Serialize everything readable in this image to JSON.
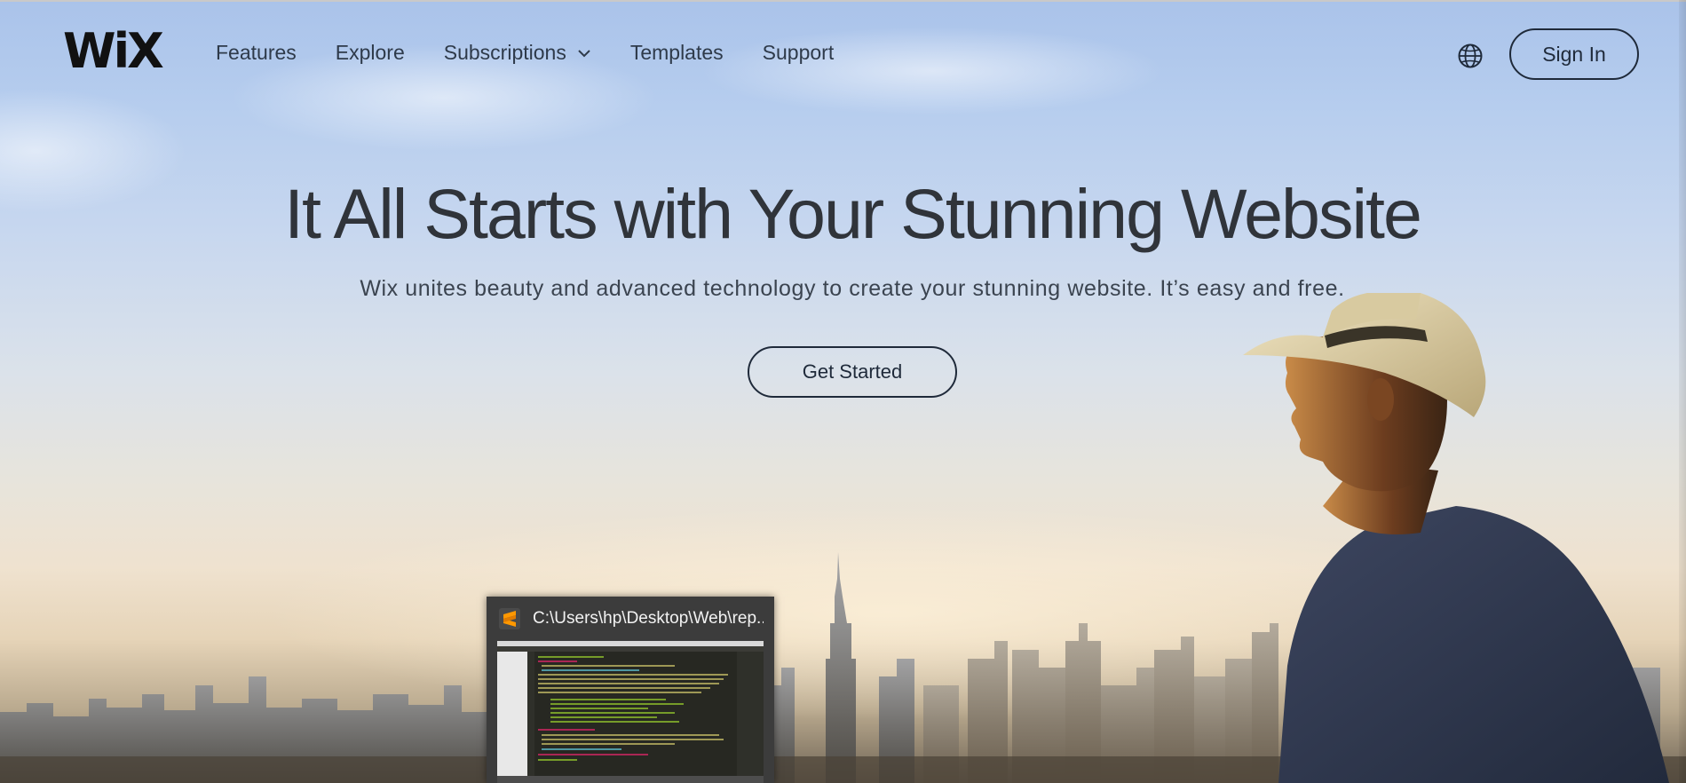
{
  "header": {
    "logo_text": "WiX",
    "nav": [
      {
        "label": "Features",
        "has_dropdown": false
      },
      {
        "label": "Explore",
        "has_dropdown": false
      },
      {
        "label": "Subscriptions",
        "has_dropdown": true
      },
      {
        "label": "Templates",
        "has_dropdown": false
      },
      {
        "label": "Support",
        "has_dropdown": false
      }
    ],
    "language_icon": "globe-icon",
    "signin_label": "Sign In"
  },
  "hero": {
    "title": "It All Starts with Your Stunning Website",
    "subtitle": "Wix unites beauty and advanced technology to create your stunning website. It’s easy and free.",
    "cta_label": "Get Started"
  },
  "taskbar_preview": {
    "app_icon": "sublime-text-icon",
    "title": "C:\\Users\\hp\\Desktop\\Web\\rep..."
  },
  "colors": {
    "text_dark": "#30343a",
    "button_border": "#1f2a3a",
    "sky_top": "#aac3ea",
    "horizon": "#efe2cf",
    "preview_bg": "#3c3c3c",
    "editor_bg": "#272822"
  }
}
